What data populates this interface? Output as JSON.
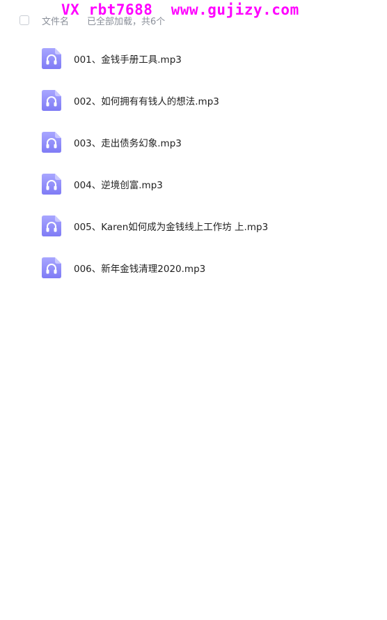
{
  "watermark": "VX rbt7688  www.gujizy.com",
  "header": {
    "column_label": "文件名",
    "load_status": "已全部加载，共6个"
  },
  "colors": {
    "icon_gradient_top": "#a8a6ff",
    "icon_gradient_bottom": "#7f7bf5",
    "text_secondary": "#8a8f99"
  },
  "files": [
    {
      "name": "001、金钱手册工具.mp3",
      "icon": "audio-file-icon"
    },
    {
      "name": "002、如何拥有有钱人的想法.mp3",
      "icon": "audio-file-icon"
    },
    {
      "name": "003、走出债务幻象.mp3",
      "icon": "audio-file-icon"
    },
    {
      "name": "004、逆境创富.mp3",
      "icon": "audio-file-icon"
    },
    {
      "name": "005、Karen如何成为金钱线上工作坊 上.mp3",
      "icon": "audio-file-icon"
    },
    {
      "name": "006、新年金钱清理2020.mp3",
      "icon": "audio-file-icon"
    }
  ]
}
